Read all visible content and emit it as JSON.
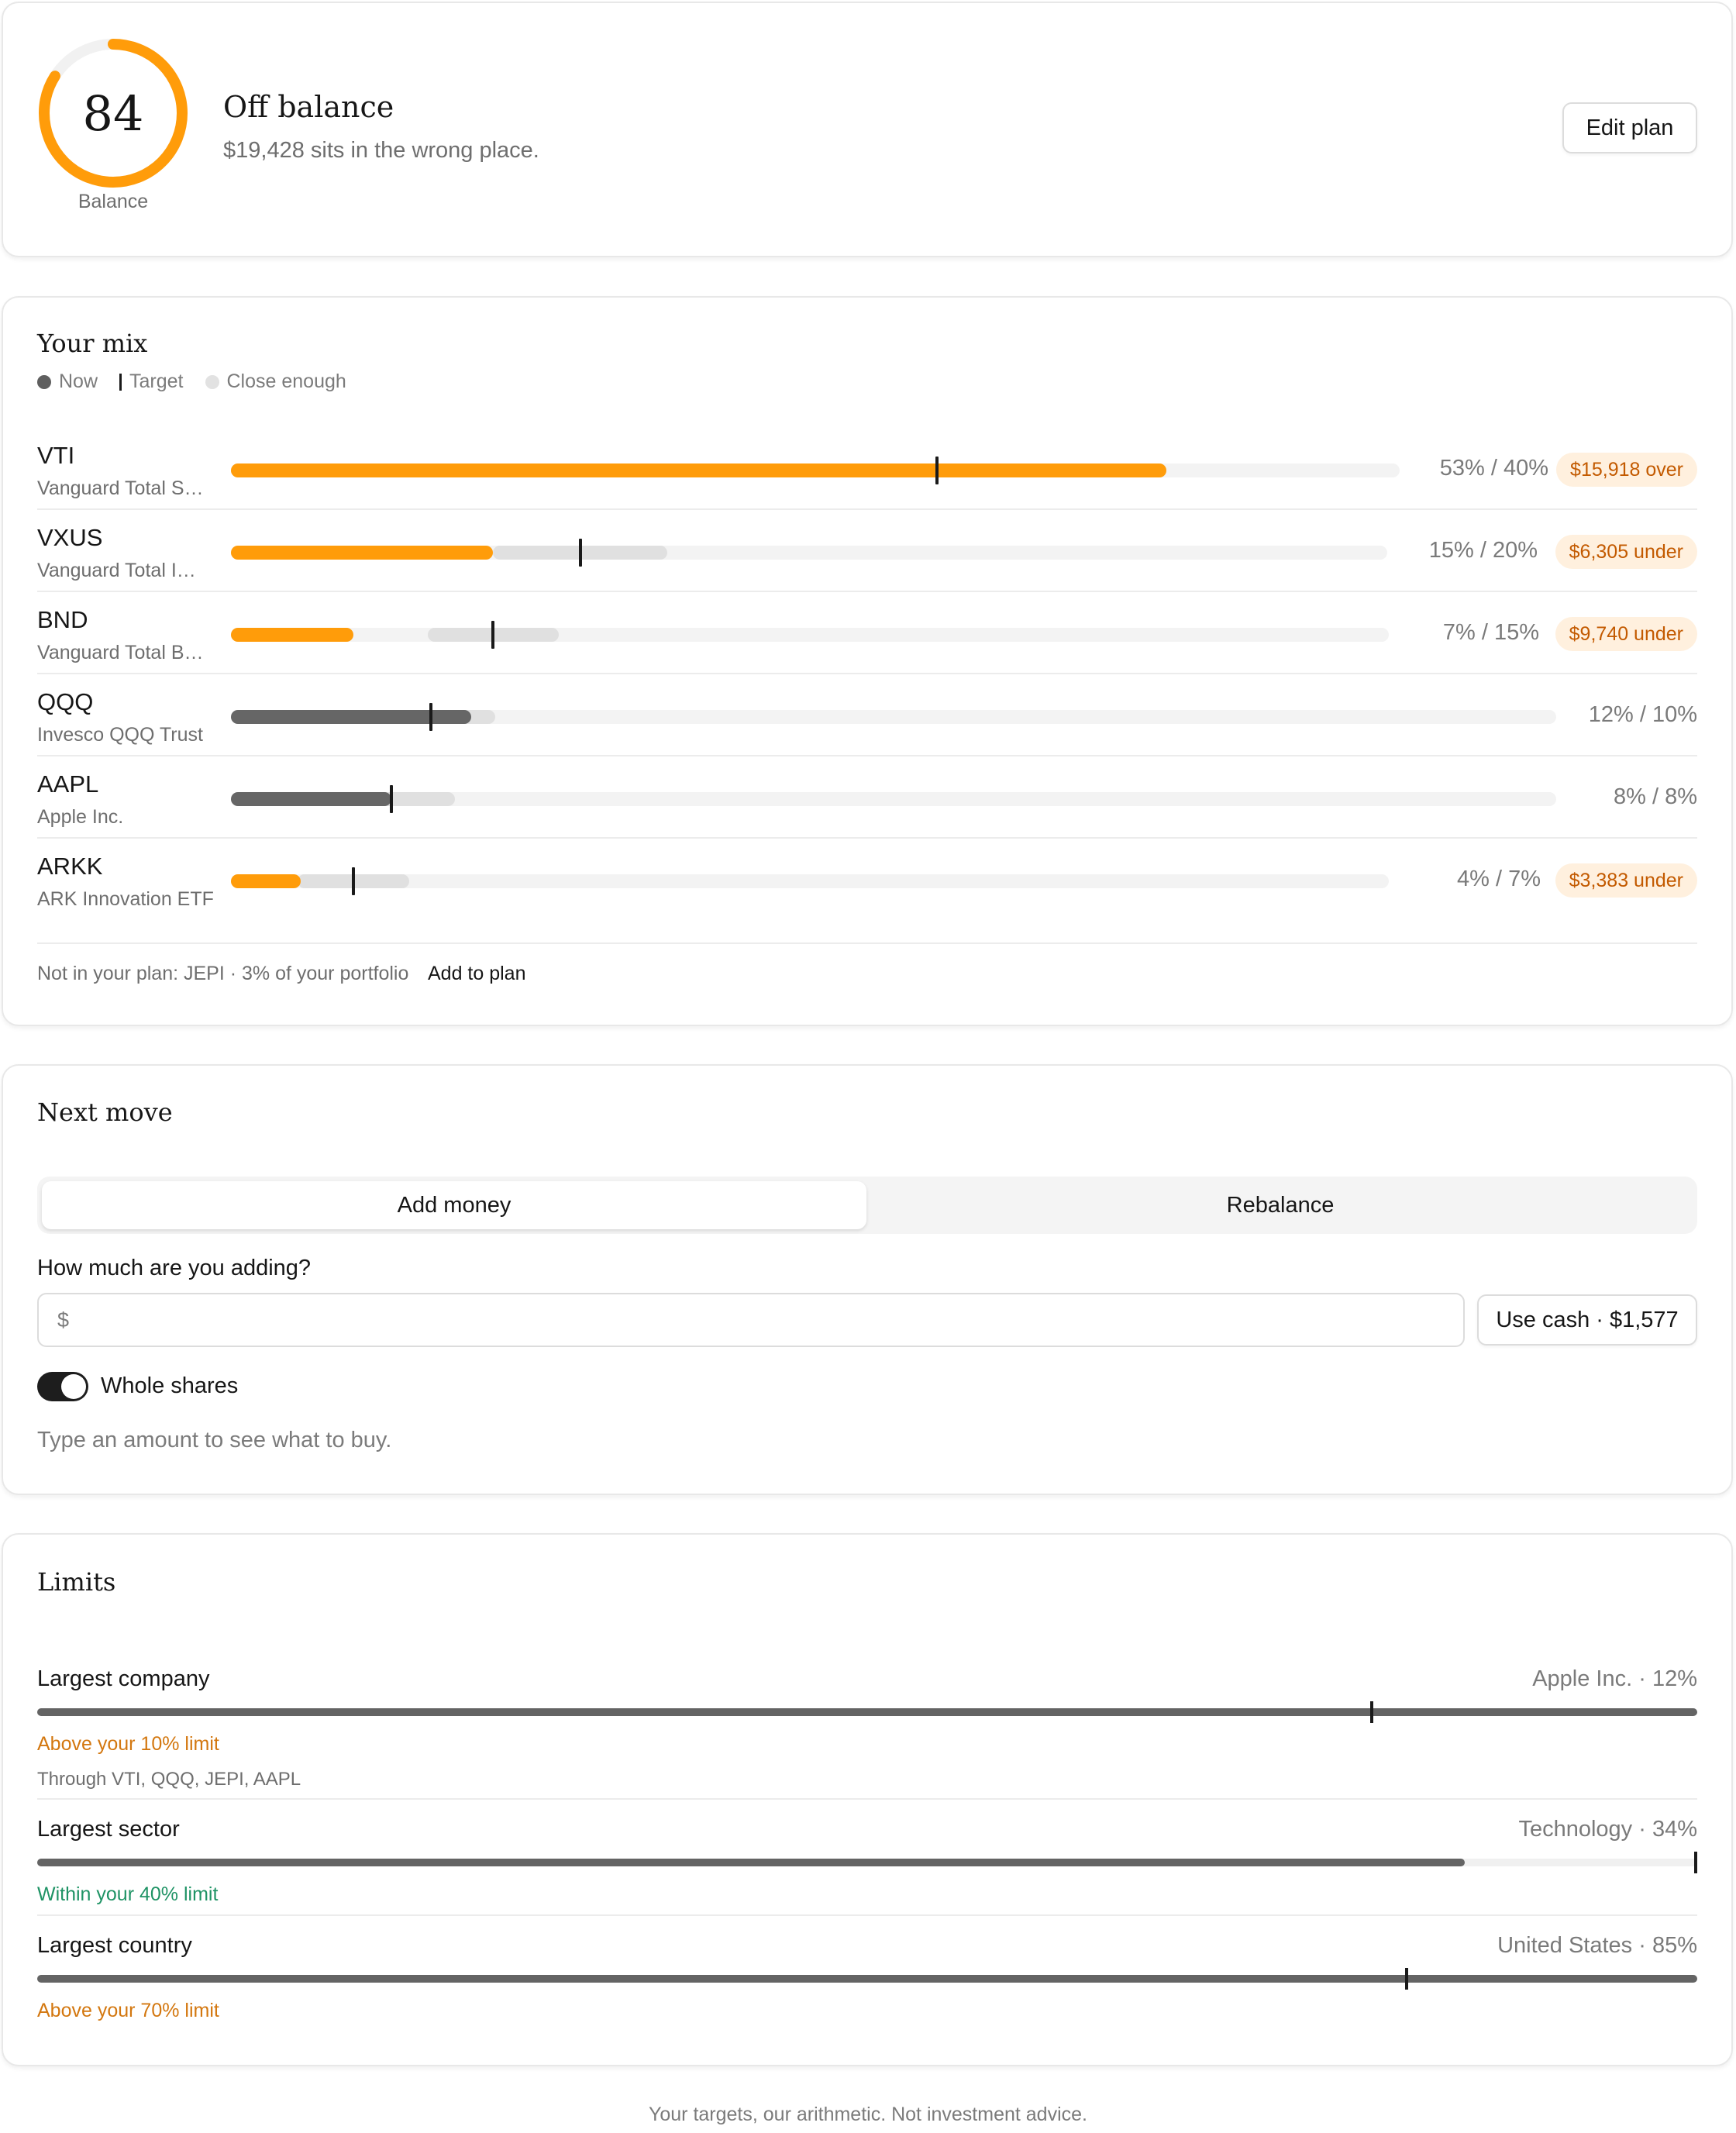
{
  "balance": {
    "score": "84",
    "score_value": 84,
    "score_max": 100,
    "score_label": "Balance",
    "title": "Off balance",
    "subtitle": "$19,428 sits in the wrong place.",
    "edit_label": "Edit plan",
    "accent": "#ff9c0a"
  },
  "mix": {
    "title": "Your mix",
    "legend": {
      "now": "Now",
      "target": "Target",
      "close": "Close enough"
    },
    "holdings": [
      {
        "symbol": "VTI",
        "name": "Vanguard Total S…",
        "now_pct": 53,
        "target_pct": 40,
        "pct_text": "53% / 40%",
        "badge": "$15,918 over",
        "status": "off"
      },
      {
        "symbol": "VXUS",
        "name": "Vanguard Total I…",
        "now_pct": 15,
        "target_pct": 20,
        "pct_text": "15% / 20%",
        "badge": "$6,305 under",
        "status": "off"
      },
      {
        "symbol": "BND",
        "name": "Vanguard Total B…",
        "now_pct": 7,
        "target_pct": 15,
        "pct_text": "7% / 15%",
        "badge": "$9,740 under",
        "status": "off"
      },
      {
        "symbol": "QQQ",
        "name": "Invesco QQQ Trust",
        "now_pct": 12,
        "target_pct": 10,
        "pct_text": "12% / 10%",
        "badge": "",
        "status": "ok"
      },
      {
        "symbol": "AAPL",
        "name": "Apple Inc.",
        "now_pct": 8,
        "target_pct": 8,
        "pct_text": "8% / 8%",
        "badge": "",
        "status": "ok"
      },
      {
        "symbol": "ARKK",
        "name": "ARK Innovation ETF",
        "now_pct": 4,
        "target_pct": 7,
        "pct_text": "4% / 7%",
        "badge": "$3,383 under",
        "status": "off"
      }
    ],
    "not_in_plan": "Not in your plan: JEPI · 3% of your portfolio",
    "add_to_plan": "Add to plan"
  },
  "next_move": {
    "title": "Next move",
    "tabs": [
      "Add money",
      "Rebalance"
    ],
    "active_tab": 0,
    "amount_label": "How much are you adding?",
    "currency": "$",
    "amount_value": "",
    "use_cash": "Use cash · $1,577",
    "whole_shares_label": "Whole shares",
    "whole_shares_on": true,
    "hint": "Type an amount to see what to buy."
  },
  "limits": {
    "title": "Limits",
    "items": [
      {
        "name": "Largest company",
        "value": "Apple Inc. · 12%",
        "fill_fraction": 1.0,
        "limit_fraction": 0.804,
        "status": "Above your 10% limit",
        "status_type": "over",
        "sub": "Through VTI, QQQ, JEPI, AAPL"
      },
      {
        "name": "Largest sector",
        "value": "Technology · 34%",
        "fill_fraction": 0.86,
        "limit_fraction": 1.0,
        "status": "Within your 40% limit",
        "status_type": "within",
        "sub": ""
      },
      {
        "name": "Largest country",
        "value": "United States · 85%",
        "fill_fraction": 1.0,
        "limit_fraction": 0.825,
        "status": "Above your 70% limit",
        "status_type": "over",
        "sub": ""
      }
    ]
  },
  "footer": "Your targets, our arithmetic. Not investment advice."
}
